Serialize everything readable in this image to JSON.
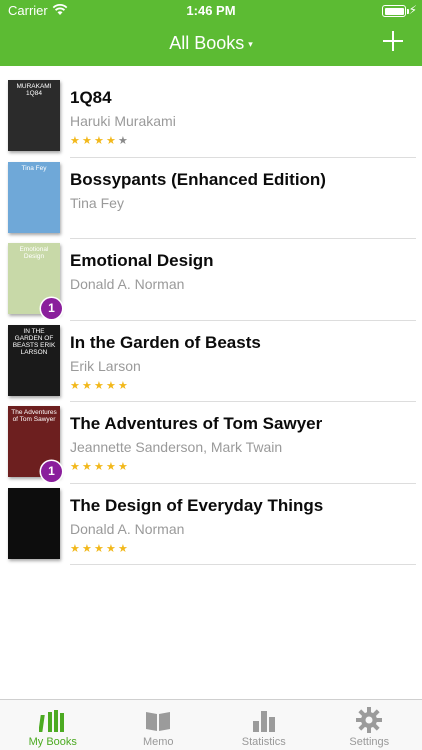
{
  "status_bar": {
    "carrier": "Carrier",
    "time": "1:46 PM"
  },
  "nav": {
    "title": "All Books",
    "caret": "▾",
    "add_icon": "plus-icon"
  },
  "books": [
    {
      "title": "1Q84",
      "author": "Haruki Murakami",
      "rating": 4,
      "max_rating": 5,
      "badge": "",
      "cover_color": "#2b2b2b",
      "cover_text": "MURAKAMI 1Q84"
    },
    {
      "title": "Bossypants (Enhanced Edition)",
      "author": "Tina Fey",
      "rating": 0,
      "max_rating": 5,
      "badge": "",
      "cover_color": "#6fa8d8",
      "cover_text": "Tina Fey"
    },
    {
      "title": "Emotional Design",
      "author": "Donald A. Norman",
      "rating": 0,
      "max_rating": 5,
      "badge": "1",
      "cover_color": "#c8d9a8",
      "cover_text": "Emotional Design"
    },
    {
      "title": "In the Garden of Beasts",
      "author": "Erik Larson",
      "rating": 5,
      "max_rating": 5,
      "badge": "",
      "cover_color": "#1a1a1a",
      "cover_text": "IN THE GARDEN OF BEASTS ERIK LARSON"
    },
    {
      "title": "The Adventures of Tom Sawyer",
      "author": "Jeannette Sanderson, Mark Twain",
      "rating": 5,
      "max_rating": 5,
      "badge": "1",
      "cover_color": "#6d1f1f",
      "cover_text": "The Adventures of Tom Sawyer"
    },
    {
      "title": "The Design of Everyday Things",
      "author": "Donald A. Norman",
      "rating": 5,
      "max_rating": 5,
      "badge": "",
      "cover_color": "#0d0d0d",
      "cover_text": ""
    }
  ],
  "tabs": [
    {
      "label": "My Books",
      "icon": "books-icon",
      "active": true
    },
    {
      "label": "Memo",
      "icon": "open-book-icon",
      "active": false
    },
    {
      "label": "Statistics",
      "icon": "bar-chart-icon",
      "active": false
    },
    {
      "label": "Settings",
      "icon": "gear-icon",
      "active": false
    }
  ],
  "colors": {
    "accent": "#5cbb33",
    "badge": "#8a1e9c",
    "star_on": "#f2b81b",
    "star_off": "#8a8a8a"
  }
}
